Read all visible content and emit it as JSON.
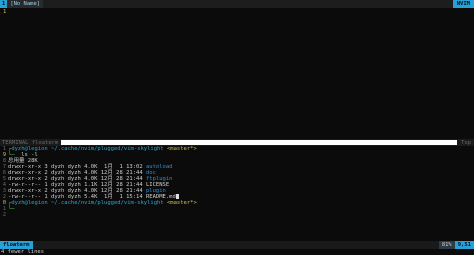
{
  "tabline": {
    "tab_number": "1",
    "tab_label": "[No Name]",
    "mode": "NVIM"
  },
  "editor": {
    "line_number": "1"
  },
  "winbar": {
    "left_label": "TERMINAL floaterm",
    "right_label": "Top"
  },
  "terminal": {
    "lines": [
      {
        "num": "1",
        "rel": true,
        "user": "dyzh@legion",
        "path": " ~/.cache/nvim/plugged/vim-skylight",
        "branch": " <master*>"
      },
      {
        "num": "9",
        "rel": false,
        "text": "  ls -l"
      },
      {
        "num": "8",
        "rel": true,
        "text": "总用量 28K"
      },
      {
        "num": "7",
        "rel": true,
        "perms": "drwxr-xr-x 3 dyzh dyzh 4.0K  1月  1 13:02 ",
        "name": "autoload",
        "is_dir": true
      },
      {
        "num": "6",
        "rel": true,
        "perms": "drwxr-xr-x 2 dyzh dyzh 4.0K 12月 28 21:44 ",
        "name": "doc",
        "is_dir": true
      },
      {
        "num": "5",
        "rel": true,
        "perms": "drwxr-xr-x 2 dyzh dyzh 4.0K 12月 28 21:44 ",
        "name": "ftplugin",
        "is_dir": true
      },
      {
        "num": "4",
        "rel": true,
        "perms": "-rw-r--r-- 1 dyzh dyzh 1.1K 12月 28 21:44 ",
        "name": "LICENSE",
        "is_dir": false
      },
      {
        "num": "3",
        "rel": true,
        "perms": "drwxr-xr-x 2 dyzh dyzh 4.0K 12月 28 21:44 ",
        "name": "plugin",
        "is_dir": true
      },
      {
        "num": "2",
        "rel": true,
        "perms": "-rw-r--r-- 1 dyzh dyzh 5.4K  1月  1 15:14 ",
        "name": "README.md",
        "is_dir": false
      },
      {
        "num": "0",
        "rel": false,
        "user": "dyzh@legion",
        "path": " ~/.cache/nvim/plugged/vim-skylight",
        "branch": " <master*>"
      },
      {
        "num": "1",
        "rel": true,
        "text": "  "
      },
      {
        "num": "2",
        "rel": true,
        "text": ""
      }
    ]
  },
  "status": {
    "name": "floaterm",
    "percent": "81%",
    "position": "9,51"
  },
  "cmdline": {
    "text": "4 fewer lines"
  }
}
